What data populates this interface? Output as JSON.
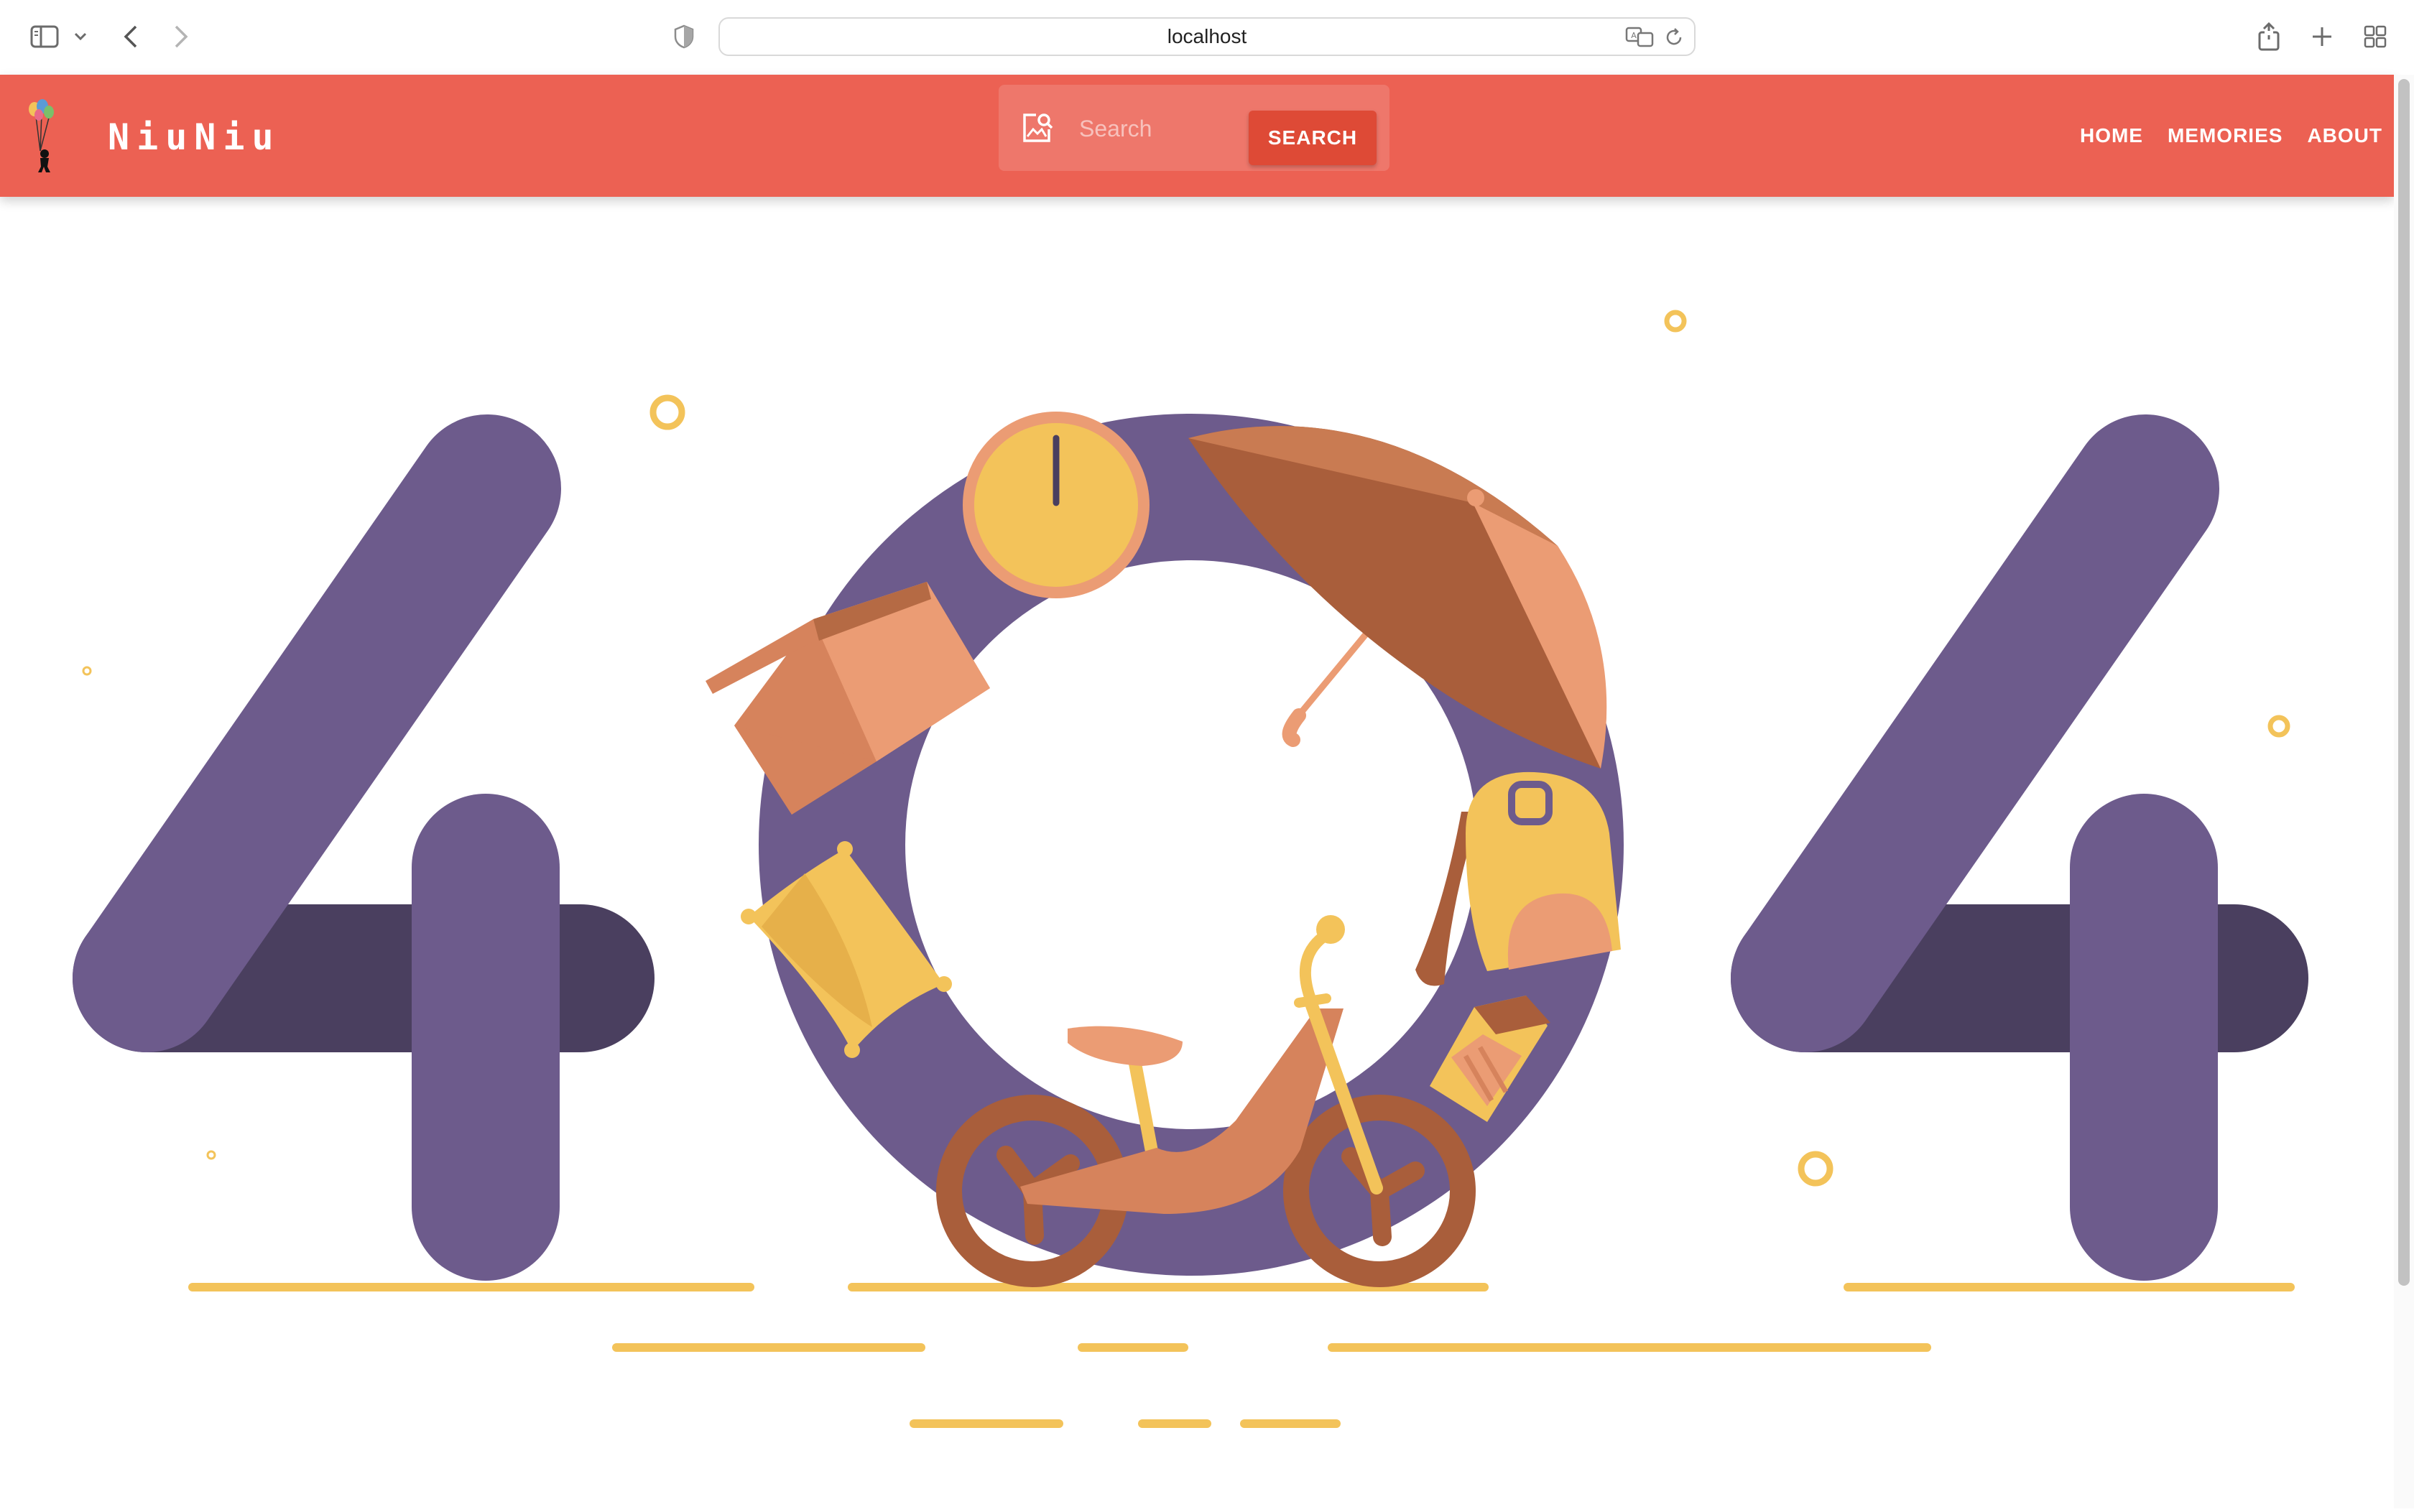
{
  "browser": {
    "url": "localhost"
  },
  "header": {
    "brand": "NiuNiu",
    "search": {
      "placeholder": "Search",
      "button_label": "SEARCH"
    },
    "nav": [
      {
        "label": "HOME"
      },
      {
        "label": "MEMORIES"
      },
      {
        "label": "ABOUT"
      }
    ]
  },
  "illustration": {
    "subject": "404 error page illustration",
    "digits": [
      "4",
      "0",
      "4"
    ],
    "icons": [
      "clock-icon",
      "box-icon",
      "umbrella-icon",
      "pillow-icon",
      "backpack-icon",
      "bicycle-icon",
      "book-icon"
    ]
  },
  "colors": {
    "header": "#ec6153",
    "search_button": "#de4a36",
    "digit_purple": "#6d5b8c",
    "digit_dark": "#4a3f5f",
    "accent_yellow": "#f3c35a",
    "accent_orange": "#eb9c74",
    "accent_brown": "#a95e3b"
  }
}
